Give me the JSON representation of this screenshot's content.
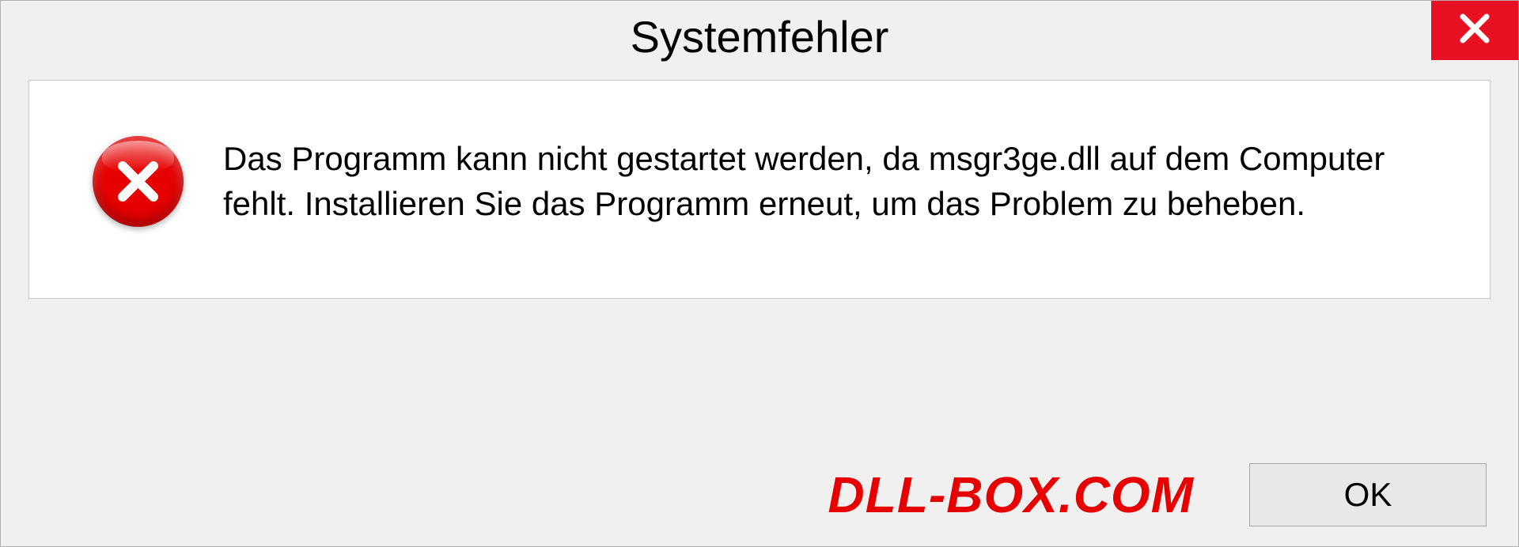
{
  "dialog": {
    "title": "Systemfehler",
    "message": "Das Programm kann nicht gestartet werden, da msgr3ge.dll auf dem Computer fehlt. Installieren Sie das Programm erneut, um das Problem zu beheben.",
    "ok_label": "OK"
  },
  "watermark": "DLL-BOX.COM"
}
